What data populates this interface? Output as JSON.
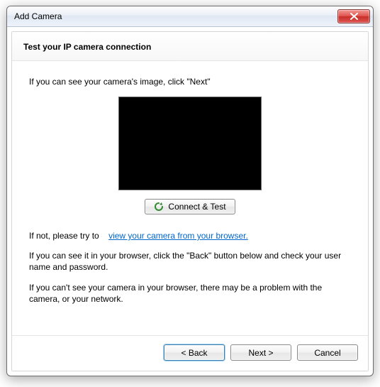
{
  "window": {
    "title": "Add Camera"
  },
  "page": {
    "heading": "Test your IP camera connection",
    "instruction": "If you can see your camera's image, click \"Next\"",
    "connect_label": "Connect & Test",
    "alt_prefix": "If not, please try to",
    "alt_link": "view your camera from your browser.",
    "para_browser_ok": "If you can see it in your browser, click the \"Back\" button below and check your user name and password.",
    "para_browser_fail": "If you can't see your camera in your browser, there may be a problem with the camera, or your network."
  },
  "footer": {
    "back": "< Back",
    "next": "Next >",
    "cancel": "Cancel"
  }
}
